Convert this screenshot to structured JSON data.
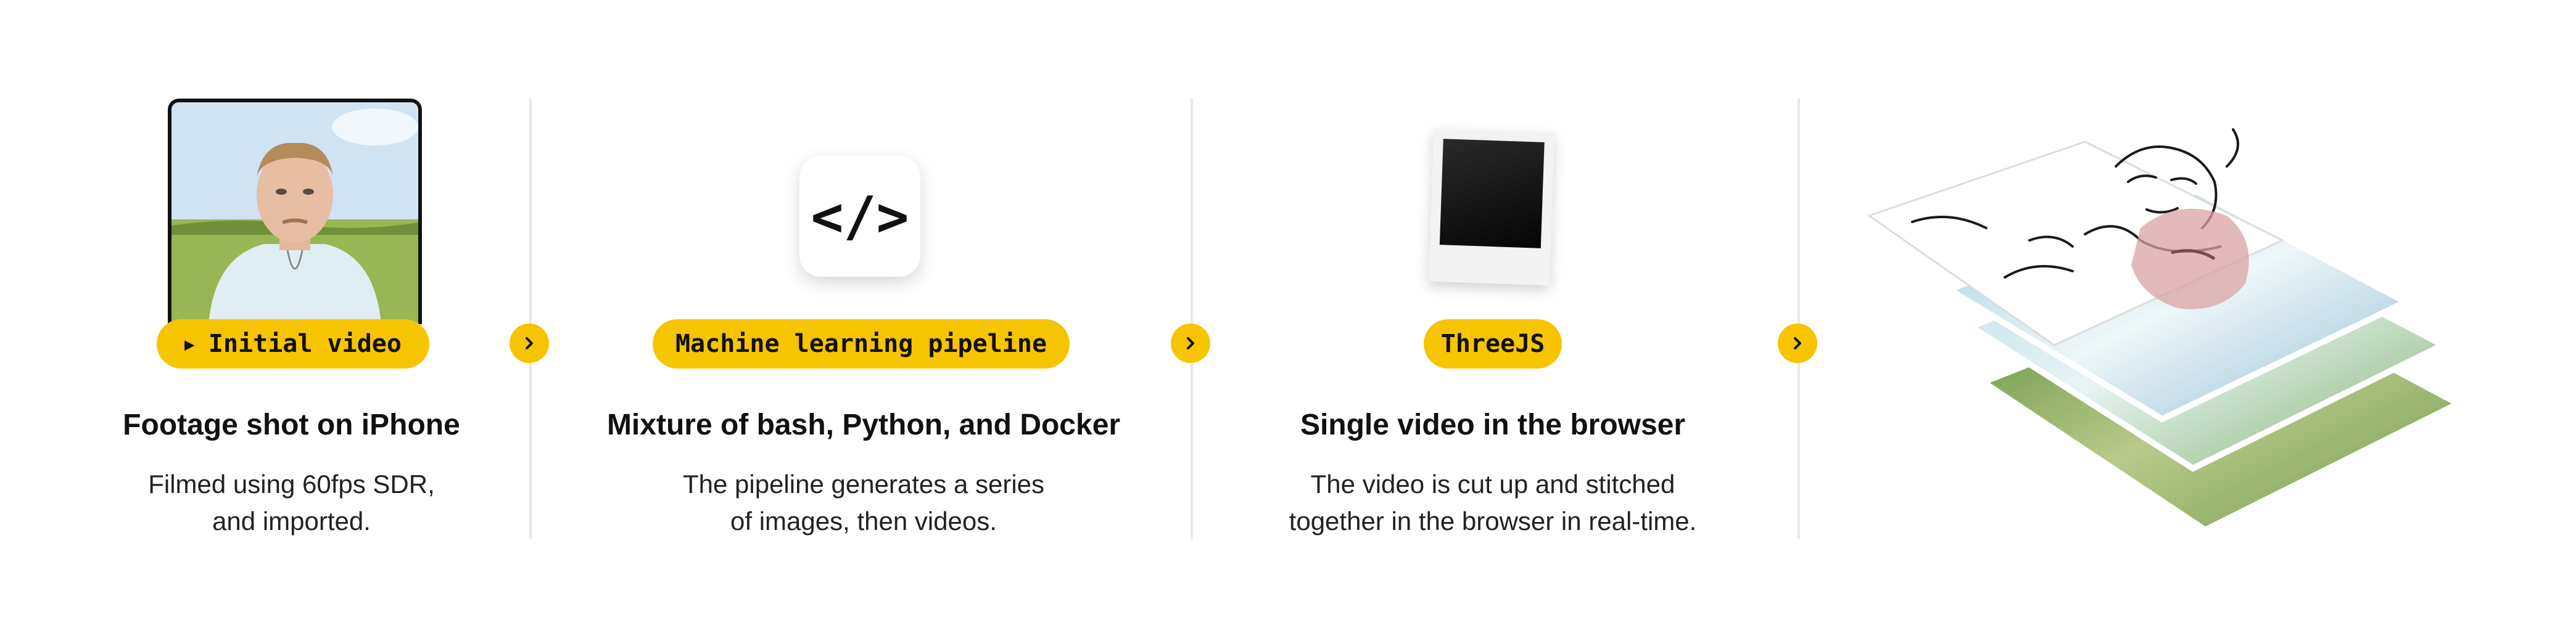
{
  "steps": [
    {
      "tag": "Initial video",
      "title": "Footage shot on iPhone",
      "desc": [
        "Filmed using 60fps SDR,",
        "and imported."
      ]
    },
    {
      "tag": "Machine learning pipeline",
      "title": "Mixture of bash, Python, and Docker",
      "desc": [
        "The pipeline generates a series",
        "of images, then videos."
      ]
    },
    {
      "tag": "ThreeJS",
      "title": "Single video in the browser",
      "desc": [
        "The video is cut up and stitched",
        "together in the browser in real-time."
      ]
    }
  ],
  "code_symbol": "</>",
  "icons": [
    "play-icon",
    "chevron-right-icon",
    "code-icon"
  ],
  "colors": {
    "accent": "#f6c400",
    "text": "#111111",
    "divider": "#e8e8e8"
  }
}
